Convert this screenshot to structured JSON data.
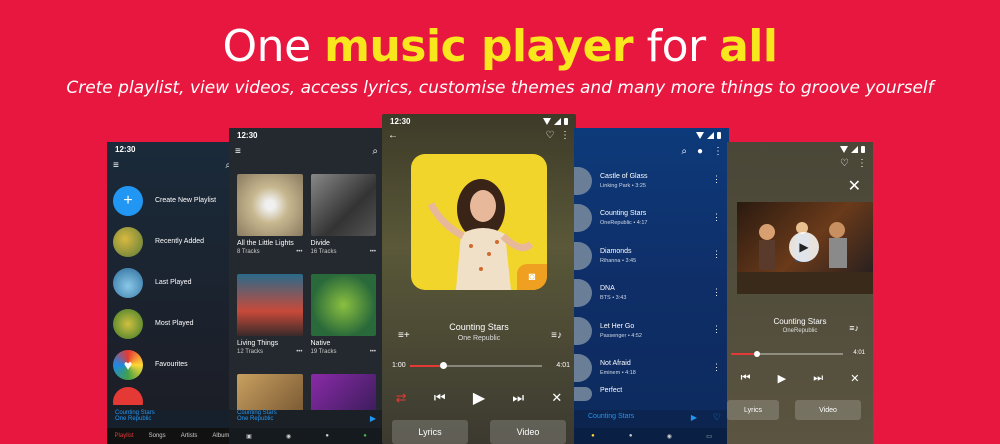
{
  "headline": {
    "w1": "One ",
    "hl": "music player",
    "w2": " for ",
    "w3": "all"
  },
  "subtitle": "Crete playlist, view videos, access lyrics, customise themes and many more things to groove yourself",
  "time": "12:30",
  "phone1": {
    "items": [
      "Create New Playlist",
      "Recently Added",
      "Last Played",
      "Most Played",
      "Favourites"
    ],
    "now_title": "Counting Stars",
    "now_artist": "One Republic",
    "nav": [
      "Playlist",
      "Songs",
      "Artists",
      "Album"
    ]
  },
  "phone2": {
    "cards": [
      {
        "title": "All the Little Lights",
        "sub": "8 Tracks"
      },
      {
        "title": "Divide",
        "sub": "16 Tracks"
      },
      {
        "title": "Living Things",
        "sub": "12 Tracks"
      },
      {
        "title": "Native",
        "sub": "19 Tracks"
      }
    ],
    "now_title": "Counting Stars",
    "now_artist": "One Republic"
  },
  "phone3": {
    "title": "Counting Stars",
    "artist": "One Republic",
    "elapsed": "1:00",
    "duration": "4:01",
    "progress": 0.25,
    "lyrics": "Lyrics",
    "video": "Video"
  },
  "phone4": {
    "songs": [
      {
        "title": "Castle of Glass",
        "sub": "Linking Park • 3:25"
      },
      {
        "title": "Counting Stars",
        "sub": "OneRepublic • 4:17"
      },
      {
        "title": "Diamonds",
        "sub": "Rihanna • 3:45"
      },
      {
        "title": "DNA",
        "sub": "BTS • 3:43"
      },
      {
        "title": "Let Her Go",
        "sub": "Passenger • 4:52"
      },
      {
        "title": "Not Afraid",
        "sub": "Eminem • 4:18"
      },
      {
        "title": "Perfect",
        "sub": ""
      }
    ],
    "now_title": "Counting Stars"
  },
  "phone5": {
    "title": "Counting Stars",
    "artist": "OneRepublic",
    "duration": "4:01",
    "progress": 0.23,
    "lyrics": "Lyrics",
    "video": "Video"
  }
}
